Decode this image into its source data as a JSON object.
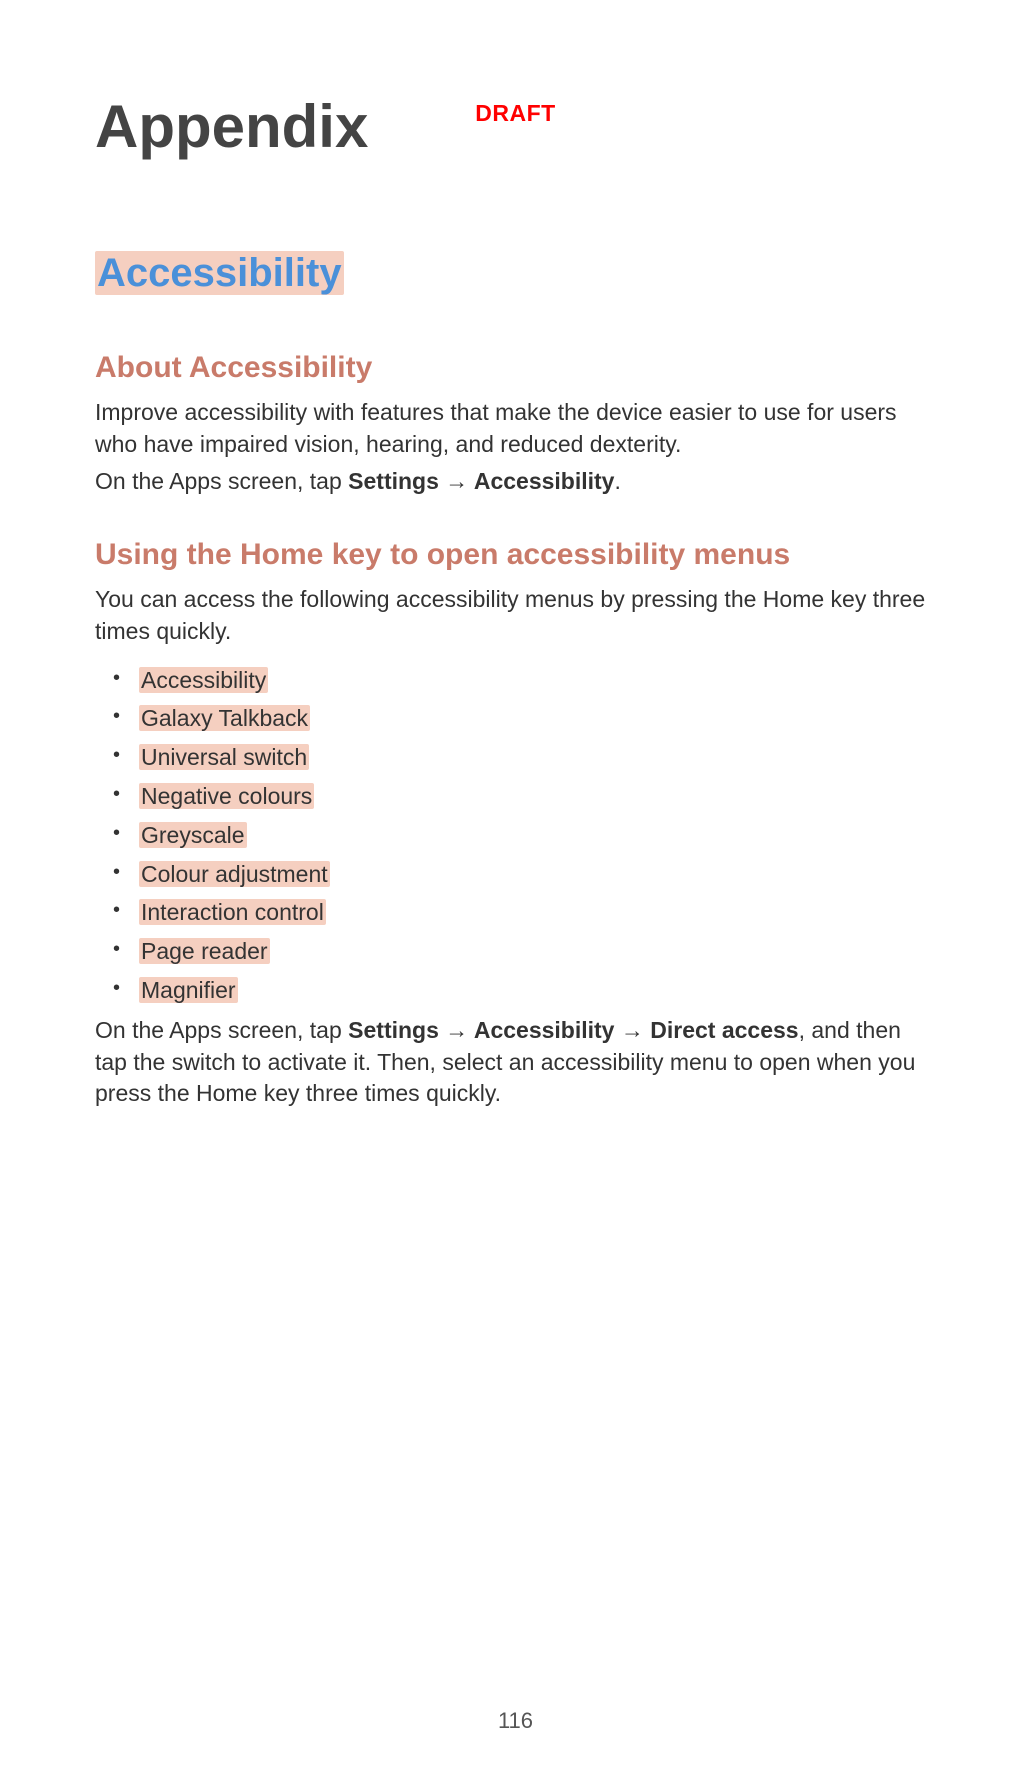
{
  "header": {
    "draft": "DRAFT"
  },
  "footer": {
    "page_number": "116"
  },
  "h1": "Appendix",
  "h2": "Accessibility",
  "section1": {
    "title": "About Accessibility",
    "p1": "Improve accessibility with features that make the device easier to use for users who have impaired vision, hearing, and reduced dexterity.",
    "p2_prefix": "On the Apps screen, tap ",
    "p2_settings": "Settings",
    "p2_arrow": " → ",
    "p2_accessibility": "Accessibility",
    "p2_suffix": "."
  },
  "section2": {
    "title": "Using the Home key to open accessibility menus",
    "intro": "You can access the following accessibility menus by pressing the Home key three times quickly.",
    "items": [
      "Accessibility",
      "Galaxy Talkback",
      "Universal switch",
      "Negative colours",
      "Greyscale",
      "Colour adjustment",
      "Interaction control",
      "Page reader",
      "Magnifier"
    ],
    "outro_prefix": "On the Apps screen, tap ",
    "outro_settings": "Settings",
    "outro_arrow1": " → ",
    "outro_accessibility": "Accessibility",
    "outro_arrow2": " → ",
    "outro_direct": "Direct access",
    "outro_suffix": ", and then tap the switch to activate it. Then, select an accessibility menu to open when you press the Home key three times quickly."
  }
}
